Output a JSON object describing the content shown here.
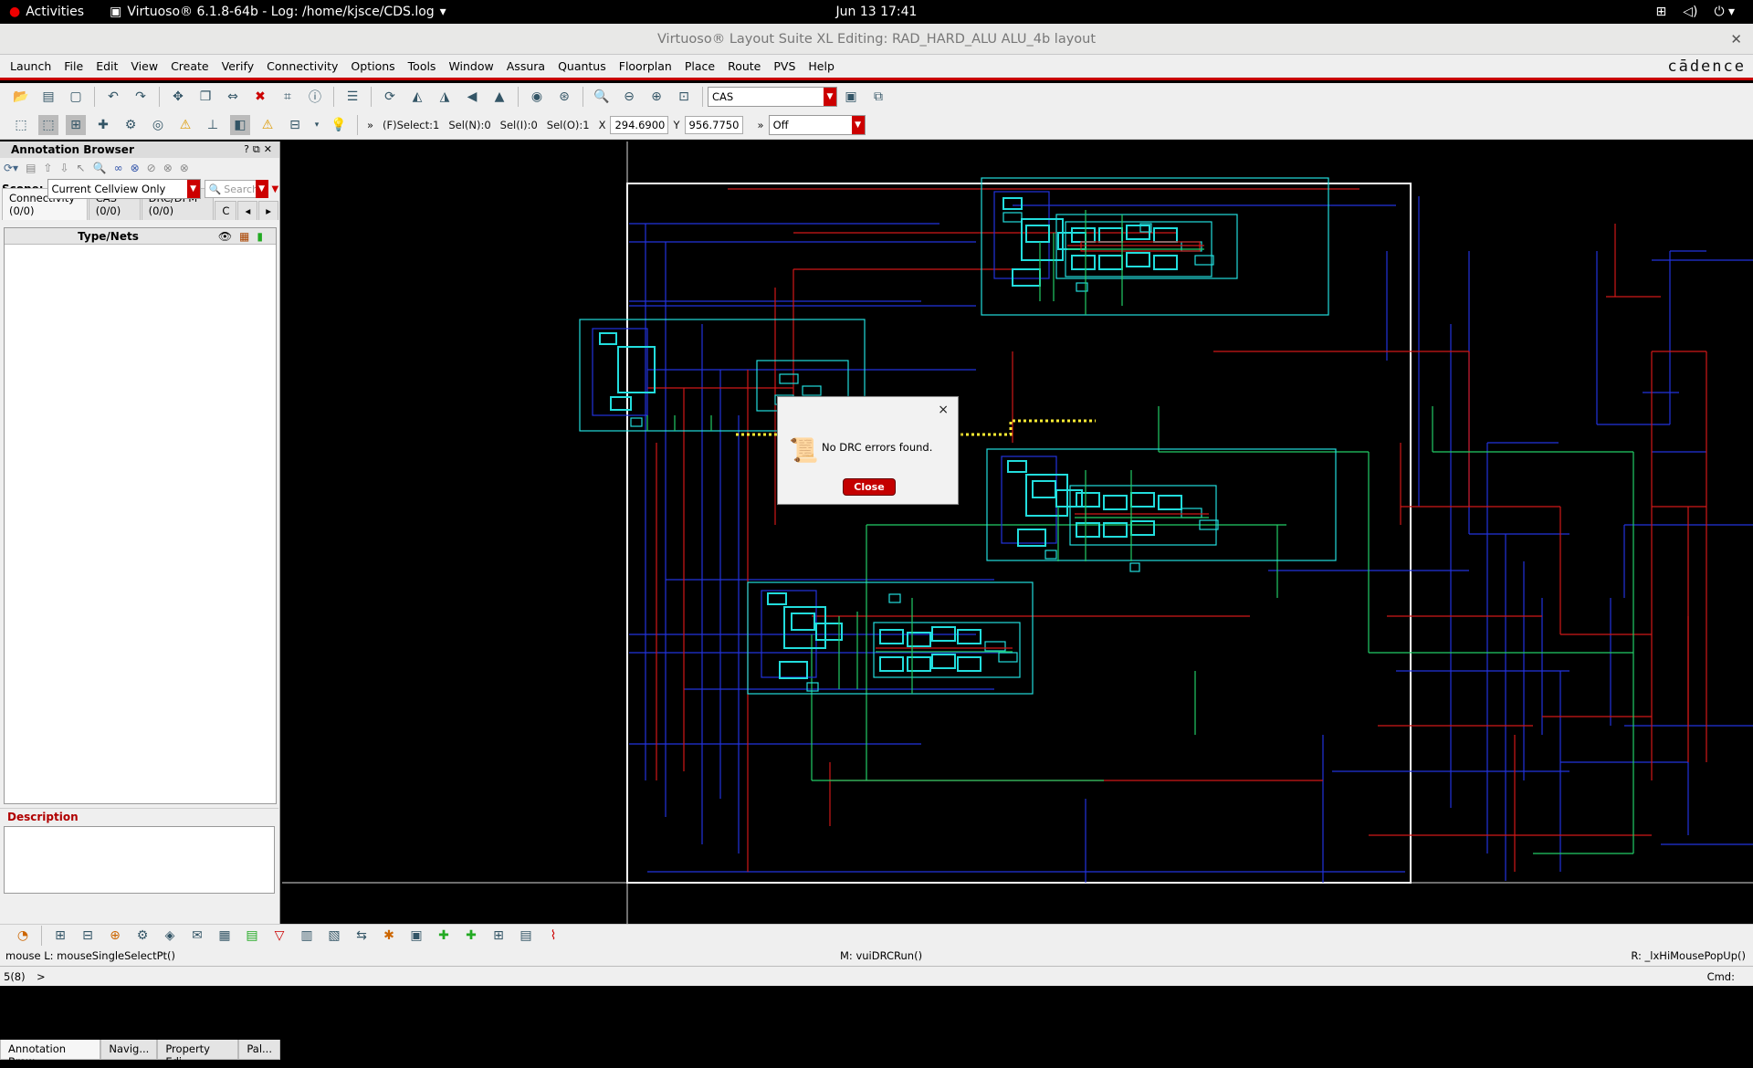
{
  "topbar": {
    "activities": "Activities",
    "app_title": "Virtuoso® 6.1.8-64b - Log: /home/kjsce/CDS.log",
    "clock": "Jun 13  17:41"
  },
  "window": {
    "title": "Virtuoso® Layout Suite XL Editing: RAD_HARD_ALU ALU_4b layout",
    "brand": "cādence"
  },
  "menu": [
    "Launch",
    "File",
    "Edit",
    "View",
    "Create",
    "Verify",
    "Connectivity",
    "Options",
    "Tools",
    "Window",
    "Assura",
    "Quantus",
    "Floorplan",
    "Place",
    "Route",
    "PVS",
    "Help"
  ],
  "toolbar": {
    "mode_combo": "CAS",
    "fselect": "(F)Select:1",
    "seln": "Sel(N):0",
    "seli": "Sel(I):0",
    "selo": "Sel(O):1",
    "x_label": "X",
    "x_value": "294.6900",
    "y_label": "Y",
    "y_value": "956.7750",
    "chevron": "»",
    "off_combo": "Off"
  },
  "annotation_browser": {
    "title": "Annotation Browser",
    "scope_label": "Scope:",
    "scope_value": "Current Cellview Only",
    "search_placeholder": "Search",
    "tabs": [
      "Connectivity (0/0)",
      "CAS (0/0)",
      "DRC/DFM (0/0)",
      "C"
    ],
    "column_header": "Type/Nets",
    "description_label": "Description"
  },
  "bottom_tabs": [
    "Annotation Brow...",
    "Navig...",
    "Property Edi...",
    "Pal..."
  ],
  "status": {
    "left": "mouse L: mouseSingleSelectPt()",
    "middle": "M: vuiDRCRun()",
    "right": "R: _lxHiMousePopUp()",
    "prompt_num": "5(8)",
    "prompt": ">",
    "cmd": "Cmd:"
  },
  "dialog": {
    "close_x": "×",
    "message": "No DRC errors found.",
    "button": "Close"
  },
  "colors": {
    "accent_red": "#c80000",
    "layout_blue": "#2233dd",
    "layout_red": "#d01818",
    "layout_cyan": "#22dddd",
    "layout_green": "#22cc66",
    "highlight_yellow": "#ffee33"
  }
}
